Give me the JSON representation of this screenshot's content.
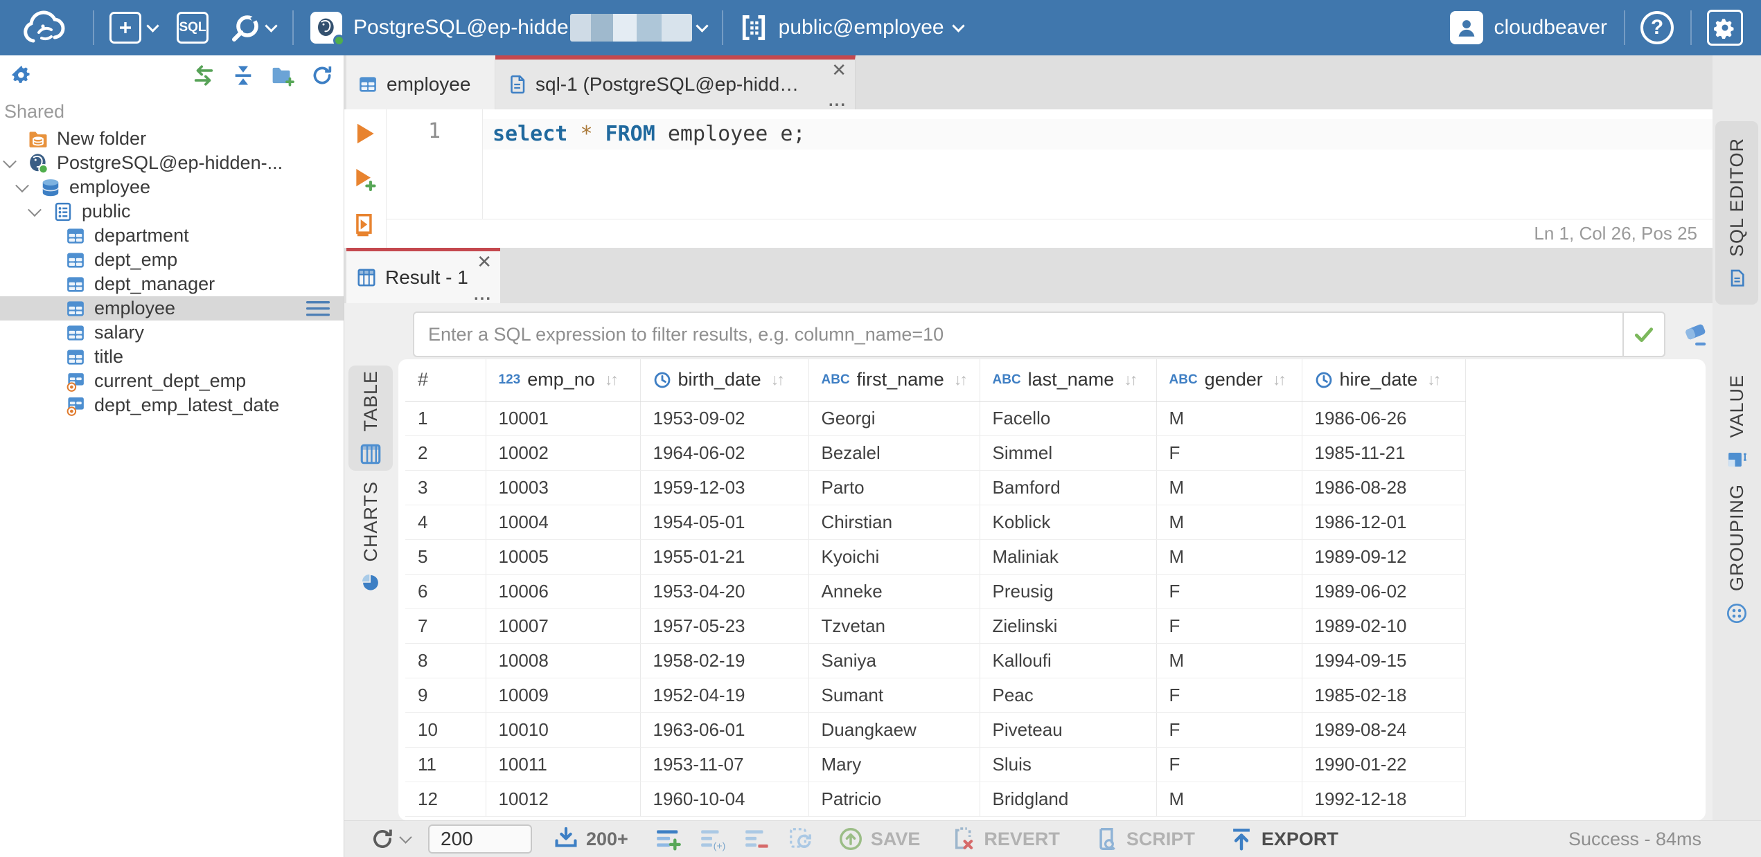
{
  "topbar": {
    "sql_button_label": "SQL",
    "connection": {
      "label": "PostgreSQL@ep-hidde"
    },
    "schema": {
      "label": "public@employee"
    },
    "user": {
      "label": "cloudbeaver"
    }
  },
  "sidebar": {
    "section_label": "Shared",
    "tree": [
      {
        "label": "New folder",
        "icon": "folder-db",
        "indent": 0,
        "chevron": false
      },
      {
        "label": "PostgreSQL@ep-hidden-...",
        "icon": "postgres",
        "indent": 0,
        "chevron": true
      },
      {
        "label": "employee",
        "icon": "database",
        "indent": 1,
        "chevron": true
      },
      {
        "label": "public",
        "icon": "schema",
        "indent": 2,
        "chevron": true
      },
      {
        "label": "department",
        "icon": "table",
        "indent": 3,
        "chevron": false
      },
      {
        "label": "dept_emp",
        "icon": "table",
        "indent": 3,
        "chevron": false
      },
      {
        "label": "dept_manager",
        "icon": "table",
        "indent": 3,
        "chevron": false
      },
      {
        "label": "employee",
        "icon": "table",
        "indent": 3,
        "chevron": false,
        "selected": true
      },
      {
        "label": "salary",
        "icon": "table",
        "indent": 3,
        "chevron": false
      },
      {
        "label": "title",
        "icon": "table",
        "indent": 3,
        "chevron": false
      },
      {
        "label": "current_dept_emp",
        "icon": "view",
        "indent": 3,
        "chevron": false
      },
      {
        "label": "dept_emp_latest_date",
        "icon": "view",
        "indent": 3,
        "chevron": false
      }
    ]
  },
  "editor": {
    "tabs": [
      {
        "label": "employee"
      },
      {
        "label": "sql-1 (PostgreSQL@ep-hidde..."
      }
    ],
    "line_number": "1",
    "code_tokens": [
      {
        "t": "select",
        "c": "kw"
      },
      {
        "t": " ",
        "c": "pl"
      },
      {
        "t": "*",
        "c": "star"
      },
      {
        "t": " ",
        "c": "pl"
      },
      {
        "t": "FROM",
        "c": "kw"
      },
      {
        "t": " employee e;",
        "c": "pl"
      }
    ],
    "status": "Ln 1, Col 26, Pos 25",
    "vertical_tab": "SQL EDITOR"
  },
  "result": {
    "tab_label": "Result - 1",
    "filter_placeholder": "Enter a SQL expression to filter results, e.g. column_name=10",
    "left_tabs": [
      "TABLE",
      "CHARTS"
    ],
    "right_tabs": [
      "VALUE",
      "GROUPING"
    ],
    "grid": {
      "row_header": "#",
      "columns": [
        {
          "name": "emp_no",
          "type": "123"
        },
        {
          "name": "birth_date",
          "type": "clock"
        },
        {
          "name": "first_name",
          "type": "abc"
        },
        {
          "name": "last_name",
          "type": "abc"
        },
        {
          "name": "gender",
          "type": "abc"
        },
        {
          "name": "hire_date",
          "type": "clock"
        }
      ],
      "rows": [
        [
          "1",
          "10001",
          "1953-09-02",
          "Georgi",
          "Facello",
          "M",
          "1986-06-26"
        ],
        [
          "2",
          "10002",
          "1964-06-02",
          "Bezalel",
          "Simmel",
          "F",
          "1985-11-21"
        ],
        [
          "3",
          "10003",
          "1959-12-03",
          "Parto",
          "Bamford",
          "M",
          "1986-08-28"
        ],
        [
          "4",
          "10004",
          "1954-05-01",
          "Chirstian",
          "Koblick",
          "M",
          "1986-12-01"
        ],
        [
          "5",
          "10005",
          "1955-01-21",
          "Kyoichi",
          "Maliniak",
          "M",
          "1989-09-12"
        ],
        [
          "6",
          "10006",
          "1953-04-20",
          "Anneke",
          "Preusig",
          "F",
          "1989-06-02"
        ],
        [
          "7",
          "10007",
          "1957-05-23",
          "Tzvetan",
          "Zielinski",
          "F",
          "1989-02-10"
        ],
        [
          "8",
          "10008",
          "1958-02-19",
          "Saniya",
          "Kalloufi",
          "M",
          "1994-09-15"
        ],
        [
          "9",
          "10009",
          "1952-04-19",
          "Sumant",
          "Peac",
          "F",
          "1985-02-18"
        ],
        [
          "10",
          "10010",
          "1963-06-01",
          "Duangkaew",
          "Piveteau",
          "F",
          "1989-08-24"
        ],
        [
          "11",
          "10011",
          "1953-11-07",
          "Mary",
          "Sluis",
          "F",
          "1990-01-22"
        ],
        [
          "12",
          "10012",
          "1960-10-04",
          "Patricio",
          "Bridgland",
          "M",
          "1992-12-18"
        ]
      ]
    }
  },
  "toolbar": {
    "fetch_size": "200",
    "fetch_more_label": "200+",
    "buttons": {
      "save": "SAVE",
      "revert": "REVERT",
      "script": "SCRIPT",
      "export": "EXPORT"
    },
    "status": "Success - 84ms"
  }
}
